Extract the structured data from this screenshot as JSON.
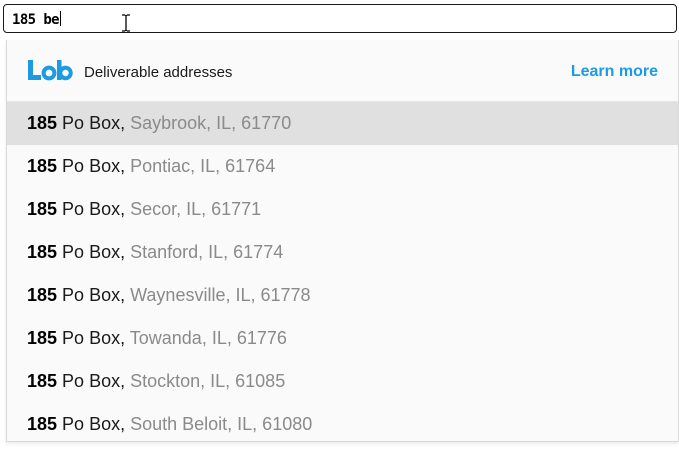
{
  "search": {
    "value": "185 be"
  },
  "dropdown": {
    "header_title": "Deliverable addresses",
    "learn_more_label": "Learn more",
    "brand_color": "#1c9be3",
    "highlight_color": "#e0e0e0"
  },
  "results": [
    {
      "number": "185",
      "street": " Po Box,",
      "locality": " Saybrook, IL, 61770",
      "highlighted": true
    },
    {
      "number": "185",
      "street": " Po Box,",
      "locality": " Pontiac, IL, 61764",
      "highlighted": false
    },
    {
      "number": "185",
      "street": " Po Box,",
      "locality": " Secor, IL, 61771",
      "highlighted": false
    },
    {
      "number": "185",
      "street": " Po Box,",
      "locality": " Stanford, IL, 61774",
      "highlighted": false
    },
    {
      "number": "185",
      "street": " Po Box,",
      "locality": " Waynesville, IL, 61778",
      "highlighted": false
    },
    {
      "number": "185",
      "street": " Po Box,",
      "locality": " Towanda, IL, 61776",
      "highlighted": false
    },
    {
      "number": "185",
      "street": " Po Box,",
      "locality": " Stockton, IL, 61085",
      "highlighted": false
    },
    {
      "number": "185",
      "street": " Po Box,",
      "locality": " South Beloit, IL, 61080",
      "highlighted": false
    }
  ]
}
